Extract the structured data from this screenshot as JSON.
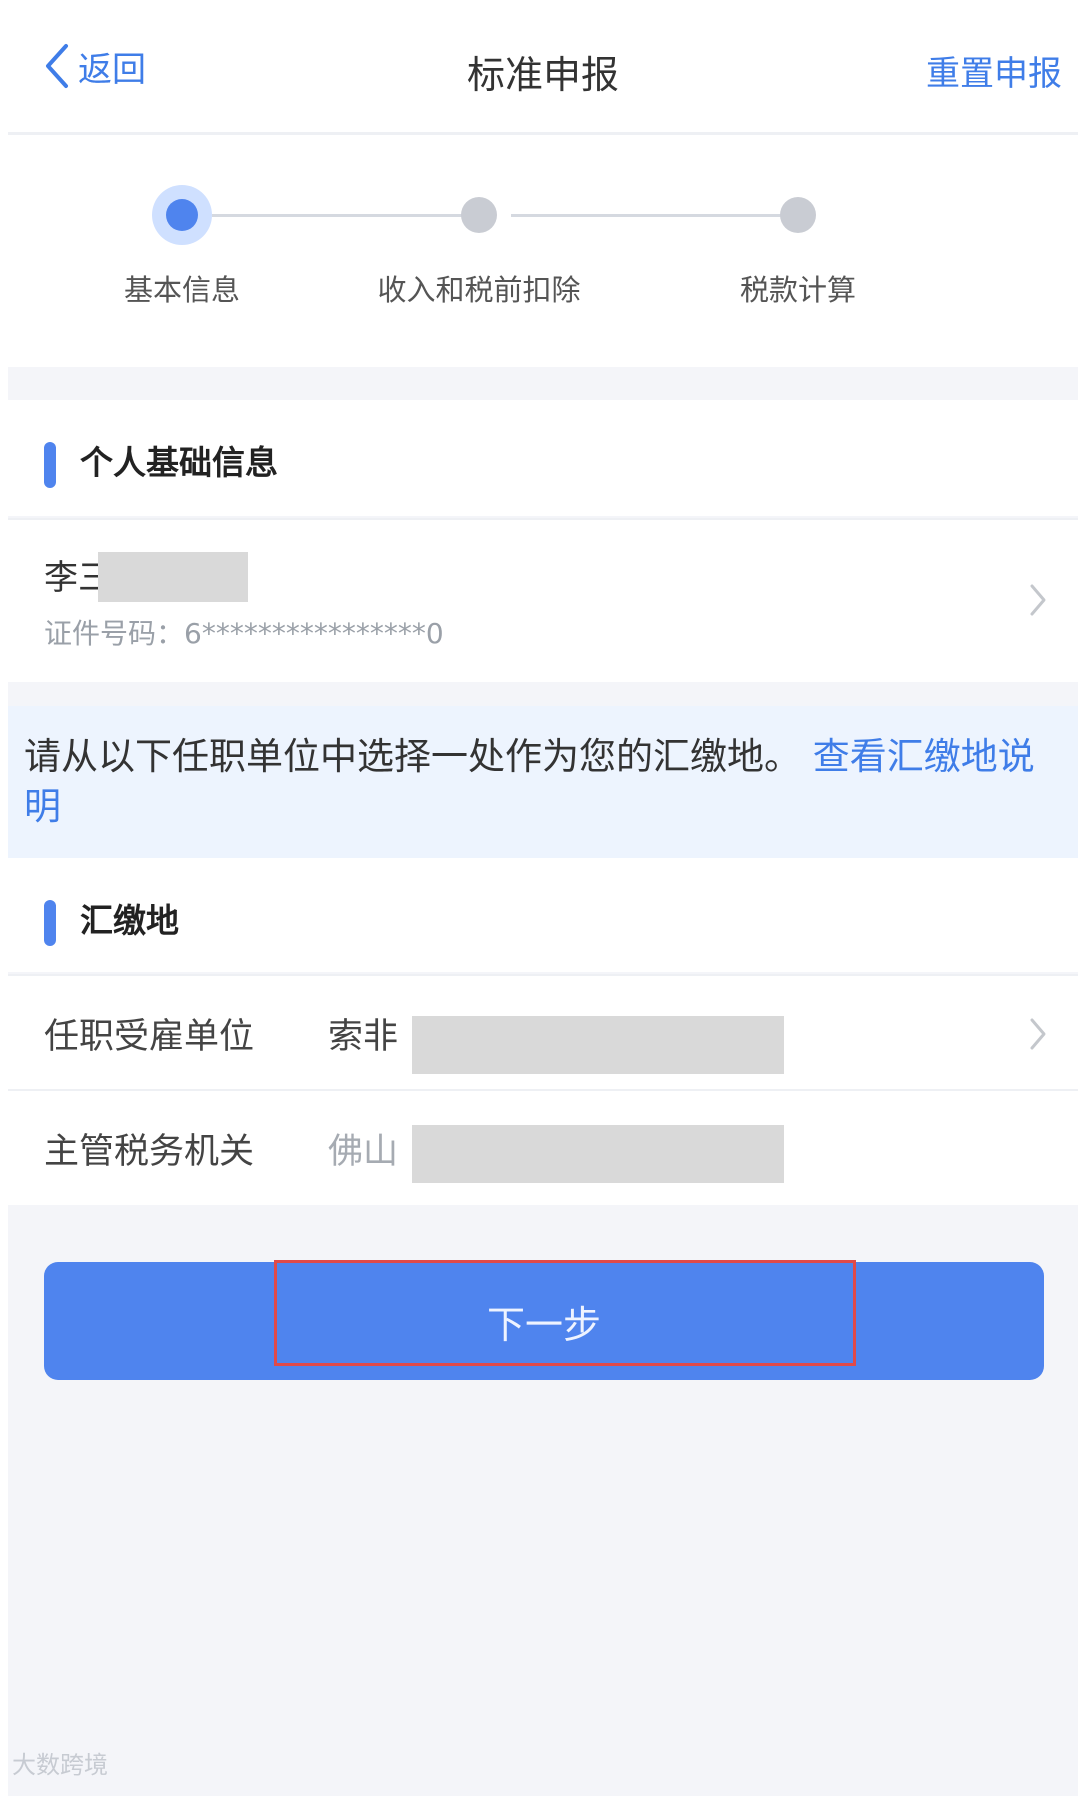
{
  "header": {
    "back_label": "返回",
    "title": "标准申报",
    "reset_label": "重置申报"
  },
  "stepper": {
    "steps": [
      {
        "label": "基本信息",
        "state": "active"
      },
      {
        "label": "收入和税前扣除",
        "state": "todo"
      },
      {
        "label": "税款计算",
        "state": "todo"
      }
    ]
  },
  "personal_section": {
    "title": "个人基础信息",
    "name_visible": "李三",
    "id_line": "证件号码：6****************0"
  },
  "notice": {
    "text": "请从以下任职单位中选择一处作为您的汇缴地。",
    "link": "查看汇缴地说明"
  },
  "payment_section": {
    "title": "汇缴地",
    "rows": [
      {
        "label": "任职受雇单位",
        "value_visible": "索非"
      },
      {
        "label": "主管税务机关",
        "value_visible": "佛山"
      }
    ]
  },
  "next_label": "下一步",
  "watermark": "大数跨境",
  "colors": {
    "primary": "#4f84ee",
    "link": "#3f7de8",
    "highlight_border": "#e04a4a",
    "notice_bg": "#edf4fe"
  }
}
